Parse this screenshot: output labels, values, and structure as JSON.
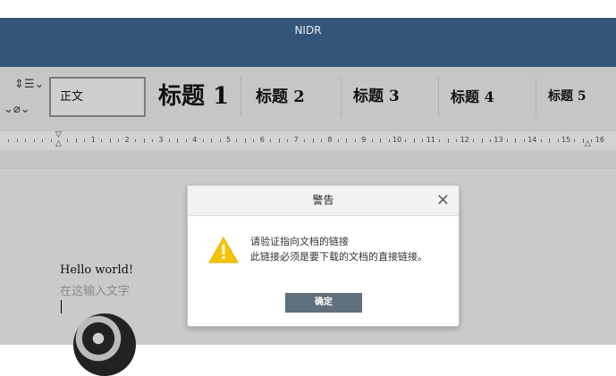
{
  "window": {
    "title": "NIDR"
  },
  "toolbar": {
    "paragraph_spacing_icon": "line-spacing-icon",
    "highlight_icon": "fill-color-icon",
    "styles": [
      {
        "label": "正文",
        "active": true
      },
      {
        "label": "标题 1"
      },
      {
        "label": "标题 2"
      },
      {
        "label": "标题 3"
      },
      {
        "label": "标题 4"
      },
      {
        "label": "标题 5"
      }
    ]
  },
  "ruler": {
    "labels": [
      "1",
      "2",
      "3",
      "4",
      "5",
      "6",
      "7",
      "8",
      "9",
      "10",
      "11",
      "12",
      "13",
      "14",
      "15",
      "16"
    ]
  },
  "document": {
    "line1": "Hello world!",
    "placeholder": "在这输入文字"
  },
  "dialog": {
    "title": "警告",
    "icon": "warning-icon",
    "message_line1": "请验证指向文档的链接",
    "message_line2": "此链接必须是要下载的文档的直接链接。",
    "ok_label": "确定",
    "close_icon": "close-icon"
  },
  "colors": {
    "titlebar": "#345578",
    "ok_button": "#5f6f7b",
    "warning": "#f5c400"
  }
}
